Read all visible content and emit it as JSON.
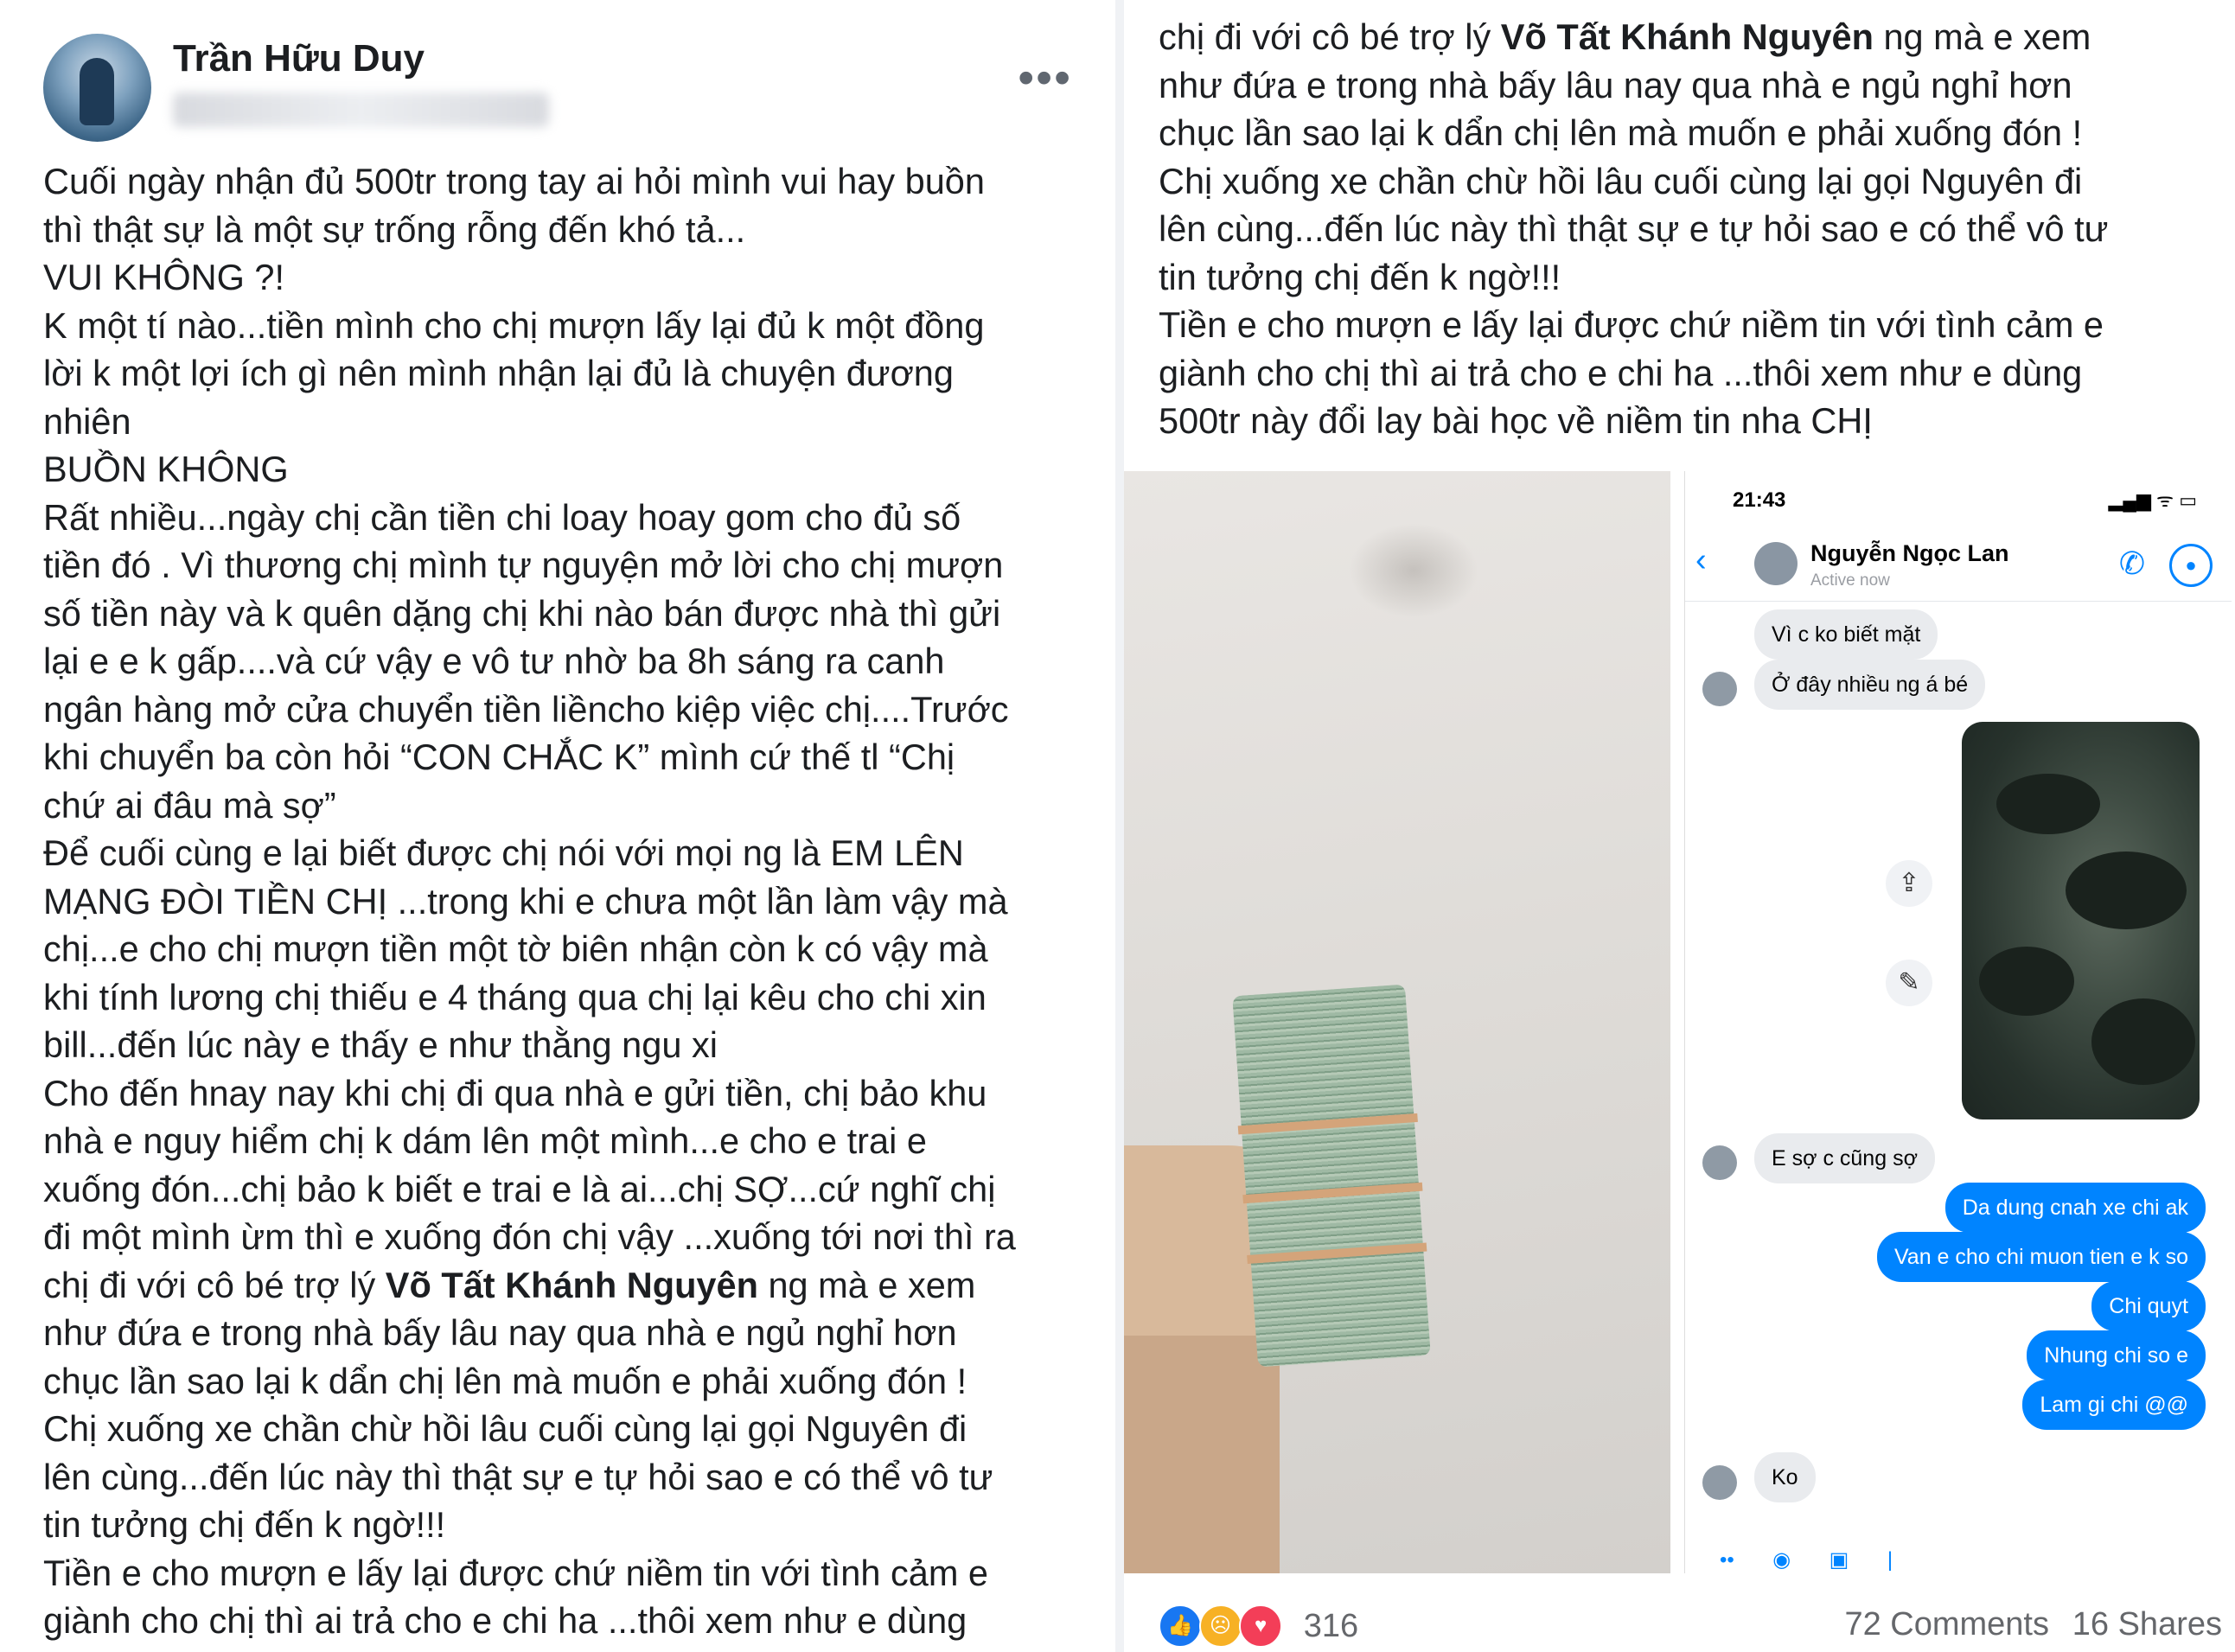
{
  "post": {
    "author": "Trần Hữu Duy",
    "more_icon": "ellipsis-icon",
    "highlighted_name": "Võ Tất Khánh Nguyên",
    "left_text_a": "Cuối ngày nhận đủ 500tr trong tay ai hỏi mình vui hay buồn\nthì thật sự là một sự trống rỗng đến khó tả...\nVUI KHÔNG ?!\nK một tí nào...tiền mình cho chị mượn lấy lại đủ k một đồng\nlời k một lợi ích gì nên mình nhận lại đủ là chuyện đương\nnhiên\nBUỒN KHÔNG\nRất nhiều...ngày chị cần tiền chi loay hoay gom cho đủ số\ntiền đó . Vì thương chị mình tự nguyện mở lời cho chị mượn\nsố tiền này và k quên dặng chị khi nào bán được nhà thì gửi\nlại e e k gấp....và cứ vậy e vô tư nhờ ba 8h sáng ra canh\nngân hàng mở cửa chuyển tiền liềncho kiệp việc chị....Trước\nkhi chuyển ba còn hỏi “CON CHẮC K” mình cứ thế tl “Chị\nchứ ai đâu mà sợ”\nĐể cuối cùng e lại biết được chị nói với mọi ng là EM LÊN\nMẠNG ĐÒI TIỀN CHỊ ...trong khi e chưa một lần làm vậy mà\nchị...e cho chị mượn tiền một tờ biên nhận còn k có vậy mà\nkhi tính lương chị thiếu e 4 tháng qua chị lại kêu cho chi xin\nbill...đến lúc này e thấy e như thằng ngu xi\nCho đến hnay nay khi chị đi qua nhà e gửi tiền, chị bảo khu\nnhà e nguy hiểm chị k dám lên một mình...e cho e trai e\nxuống đón...chị bảo k biết e trai e là ai...chị SỢ...cứ nghĩ chị\nđi một mình ừm thì e xuống đón chị vậy ...xuống tới nơi thì ra\nchị đi với cô bé trợ lý ",
    "left_text_b": " ng mà e xem\nnhư đứa e trong nhà bấy lâu nay qua nhà e ngủ nghỉ hơn\nchục lần sao lại k dẩn chị lên mà muốn e phải xuống đón !\nChị xuống xe chần chừ hồi lâu cuối cùng lại gọi Nguyên đi\nlên cùng...đến lúc này thì thật sự e tự hỏi sao e có thể vô tư\ntin tưởng chị đến k ngờ!!!\nTiền e cho mượn e lấy lại được chứ niềm tin với tình cảm e\ngiành cho chị thì ai trả cho e chi ha ...thôi xem như e dùng",
    "right_text_a": "chị đi với cô bé trợ lý ",
    "right_text_b": " ng mà e xem\nnhư đứa e trong nhà bấy lâu nay qua nhà e ngủ nghỉ hơn\nchục lần sao lại k dẩn chị lên mà muốn e phải xuống đón !\nChị xuống xe chần chừ hồi lâu cuối cùng lại gọi Nguyên đi\nlên cùng...đến lúc này thì thật sự e tự hỏi sao e có thể vô tư\ntin tưởng chị đến k ngờ!!!\nTiền e cho mượn e lấy lại được chứ niềm tin với tình cảm e\ngiành cho chị thì ai trả cho e chi ha ...thôi xem như e dùng\n500tr này đổi lay bài học về niềm tin nha CHỊ"
  },
  "chat": {
    "time": "21:43",
    "status_icons": "▂▄▆ ᯤ ▭",
    "contact_name": "Nguyễn Ngọc Lan",
    "active_status": "Active now",
    "back_icon": "‹",
    "messages": [
      {
        "text": "Vì c ko biết mặt",
        "dir": "in"
      },
      {
        "text": "Ở đây nhiều ng á bé",
        "dir": "in"
      },
      {
        "text": "E sợ c cũng sợ",
        "dir": "in"
      },
      {
        "text": "Da dung cnah xe chi ak",
        "dir": "out"
      },
      {
        "text": "Van e cho chi muon tien e k so",
        "dir": "out"
      },
      {
        "text": "Chi quyt",
        "dir": "out"
      },
      {
        "text": "Nhung chi so e",
        "dir": "out"
      },
      {
        "text": "Lam gi chi @@",
        "dir": "out"
      },
      {
        "text": "Ko",
        "dir": "in"
      }
    ]
  },
  "footer": {
    "reaction_count": "316",
    "comments": "72 Comments",
    "shares": "16 Shares"
  },
  "colors": {
    "messenger_blue": "#0084ff",
    "facebook_blue": "#1877f2"
  }
}
